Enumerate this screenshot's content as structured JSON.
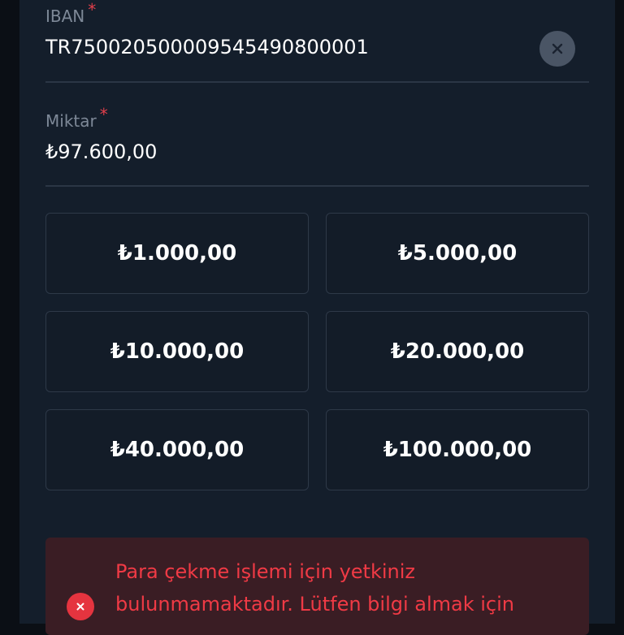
{
  "iban_field": {
    "label": "IBAN",
    "required_mark": "*",
    "value": "TR750020500009545490800001",
    "clear_icon": "close-icon"
  },
  "amount_field": {
    "label": "Miktar",
    "required_mark": "*",
    "value": "₺97.600,00"
  },
  "quick_amounts": [
    "₺1.000,00",
    "₺5.000,00",
    "₺10.000,00",
    "₺20.000,00",
    "₺40.000,00",
    "₺100.000,00"
  ],
  "error": {
    "icon": "error-close-icon",
    "message": "Para çekme işlemi için yetkiniz bulunmamaktadır. Lütfen bilgi almak için"
  },
  "colors": {
    "background": "#0b0f15",
    "panel": "#141e2b",
    "accent_error": "#e5343f",
    "error_bg": "#3a1d24"
  }
}
